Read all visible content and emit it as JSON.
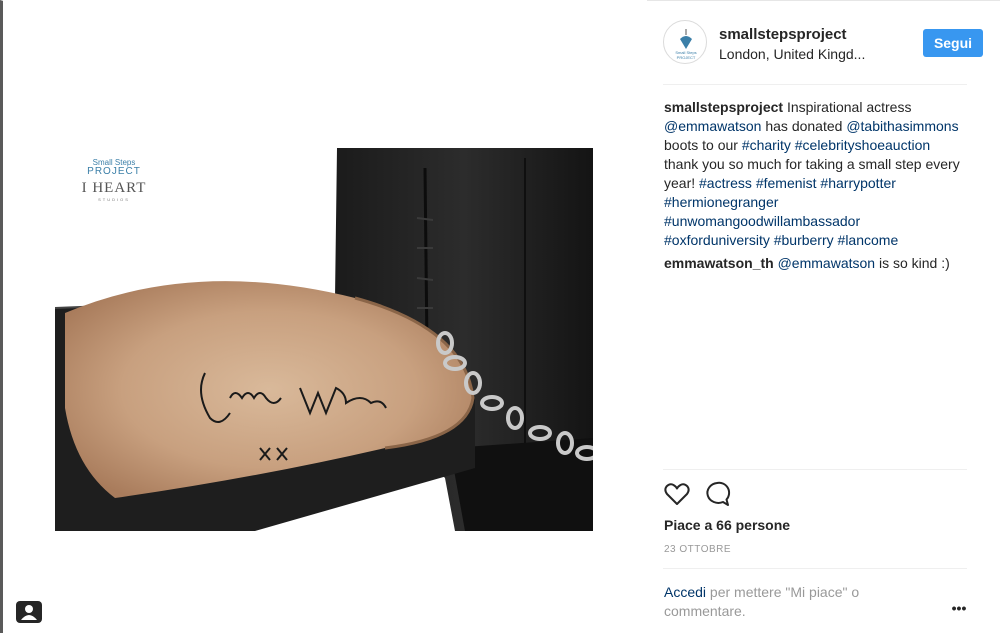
{
  "post": {
    "username": "smallstepsproject",
    "location": "London, United Kingd...",
    "follow_label": "Segui",
    "avatar_text_top": "Small Steps",
    "avatar_text_bottom": "PROJECT"
  },
  "photo": {
    "logo_small_steps": "Small Steps",
    "logo_project": "PROJECT",
    "logo_i_heart": "I HEART",
    "logo_studios": "STUDIOS",
    "signature": "Emma Watson",
    "signature_xx": "xx"
  },
  "comments": [
    {
      "user": "smallstepsproject",
      "parts": [
        {
          "text": " Inspirational actress ",
          "tag": false
        },
        {
          "text": "@emmawatson",
          "tag": true
        },
        {
          "text": " has donated ",
          "tag": false
        },
        {
          "text": "@tabithasimmons",
          "tag": true
        },
        {
          "text": " boots to our ",
          "tag": false
        },
        {
          "text": "#charity",
          "tag": true
        },
        {
          "text": " ",
          "tag": false
        },
        {
          "text": "#celebrityshoeauction",
          "tag": true
        },
        {
          "text": " thank you so much for taking a small step every year! ",
          "tag": false
        },
        {
          "text": "#actress",
          "tag": true
        },
        {
          "text": " ",
          "tag": false
        },
        {
          "text": "#femenist",
          "tag": true
        },
        {
          "text": " ",
          "tag": false
        },
        {
          "text": "#harrypotter",
          "tag": true
        },
        {
          "text": " ",
          "tag": false
        },
        {
          "text": "#hermionegranger",
          "tag": true
        },
        {
          "text": " ",
          "tag": false
        },
        {
          "text": "#unwomangoodwillambassador",
          "tag": true
        },
        {
          "text": " ",
          "tag": false
        },
        {
          "text": "#oxforduniversity",
          "tag": true
        },
        {
          "text": " ",
          "tag": false
        },
        {
          "text": "#burberry",
          "tag": true
        },
        {
          "text": " ",
          "tag": false
        },
        {
          "text": "#lancome",
          "tag": true
        }
      ]
    },
    {
      "user": "emmawatson_th",
      "parts": [
        {
          "text": " ",
          "tag": false
        },
        {
          "text": "@emmawatson",
          "tag": true
        },
        {
          "text": " is so kind :)",
          "tag": false
        }
      ]
    }
  ],
  "actions": {
    "like_icon": "heart-outline-icon",
    "comment_icon": "comment-bubble-icon"
  },
  "likes_text": "Piace a 66 persone",
  "date_text": "23 OTTOBRE",
  "login": {
    "link": "Accedi",
    "rest": " per mettere \"Mi piace\" o commentare."
  },
  "more_label": "•••",
  "colors": {
    "follow_button": "#3897f0",
    "link": "#003569",
    "muted": "#999999",
    "text": "#262626"
  }
}
